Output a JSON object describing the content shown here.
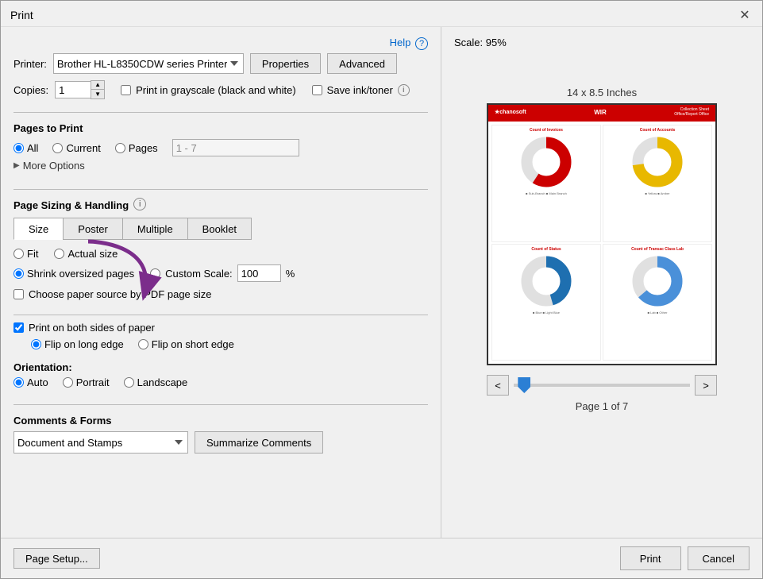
{
  "dialog": {
    "title": "Print",
    "close_label": "✕"
  },
  "header": {
    "help_label": "Help",
    "info_symbol": "?"
  },
  "printer": {
    "label": "Printer:",
    "value": "Brother HL-L8350CDW series Printer",
    "properties_btn": "Properties",
    "advanced_btn": "Advanced"
  },
  "copies": {
    "label": "Copies:",
    "value": "1"
  },
  "options": {
    "grayscale_label": "Print in grayscale (black and white)",
    "ink_label": "Save ink/toner",
    "info_symbol": "ⓘ"
  },
  "pages_to_print": {
    "section_title": "Pages to Print",
    "all_label": "All",
    "current_label": "Current",
    "pages_label": "Pages",
    "pages_value": "1 - 7",
    "more_options_label": "More Options"
  },
  "page_sizing": {
    "section_title": "Page Sizing & Handling",
    "info_symbol": "ⓘ",
    "tabs": [
      "Size",
      "Poster",
      "Multiple",
      "Booklet"
    ],
    "active_tab": "Size",
    "fit_label": "Fit",
    "actual_size_label": "Actual size",
    "shrink_label": "Shrink oversized pages",
    "custom_scale_label": "Custom Scale:",
    "custom_scale_value": "100",
    "custom_scale_pct": "%",
    "choose_paper_label": "Choose paper source by PDF page size"
  },
  "both_sides": {
    "label": "Print on both sides of paper",
    "flip_long_label": "Flip on long edge",
    "flip_short_label": "Flip on short edge"
  },
  "orientation": {
    "section_title": "Orientation:",
    "auto_label": "Auto",
    "portrait_label": "Portrait",
    "landscape_label": "Landscape"
  },
  "comments": {
    "section_title": "Comments & Forms",
    "dropdown_value": "Document and Stamps",
    "summarize_btn": "Summarize Comments"
  },
  "preview": {
    "scale_text": "Scale:  95%",
    "size_label": "14 x 8.5 Inches",
    "page_info": "Page 1 of 7"
  },
  "pagination": {
    "prev_label": "<",
    "next_label": ">"
  },
  "bottom": {
    "page_setup_btn": "Page Setup...",
    "print_btn": "Print",
    "cancel_btn": "Cancel"
  }
}
